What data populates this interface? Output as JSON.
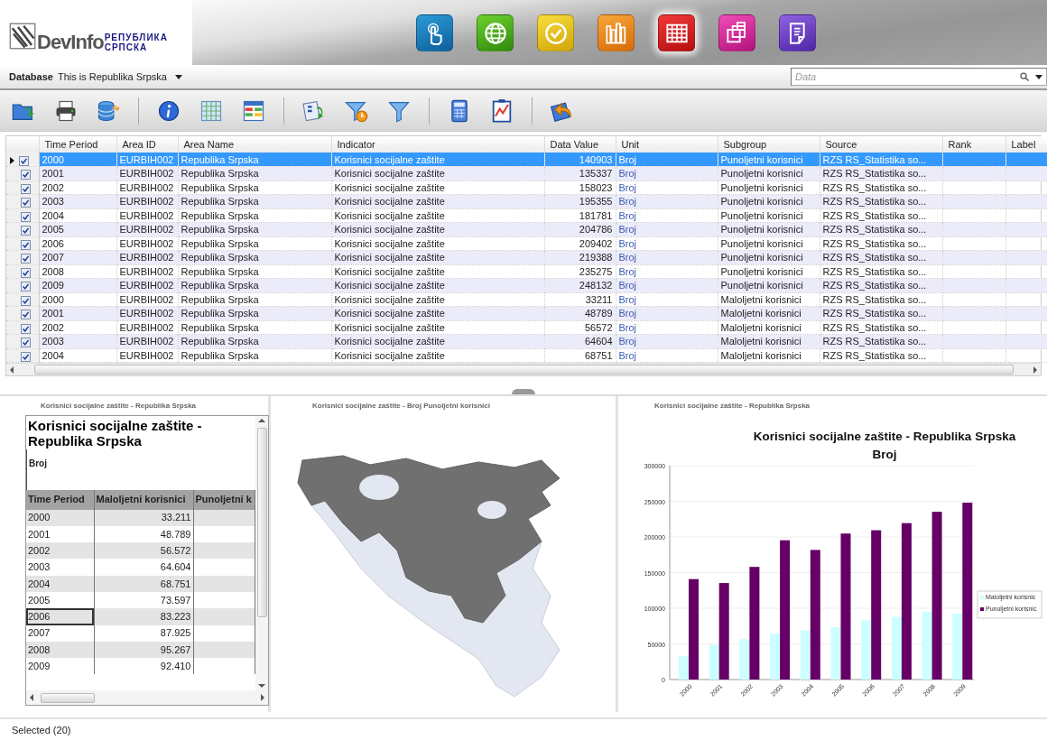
{
  "header": {
    "logo": {
      "name": "DevInfo",
      "line_1": "РЕПУБЛИКА",
      "line_2": "СРПСКА"
    },
    "app_icons": [
      {
        "kind": "touch",
        "selected": false
      },
      {
        "kind": "globe",
        "selected": false
      },
      {
        "kind": "check",
        "selected": false
      },
      {
        "kind": "books",
        "selected": false
      },
      {
        "kind": "grid",
        "selected": true
      },
      {
        "kind": "copy",
        "selected": false
      },
      {
        "kind": "document",
        "selected": false
      }
    ]
  },
  "database_bar": {
    "label": "Database",
    "value": "This is Republika Srpska"
  },
  "search": {
    "placeholder": "Data"
  },
  "table": {
    "columns": [
      "Time Period",
      "Area ID",
      "Area Name",
      "Indicator",
      "Data Value",
      "Unit",
      "Subgroup",
      "Source",
      "Rank",
      "Label"
    ],
    "rows": [
      {
        "selected": true,
        "checked": true,
        "cells": [
          "2000",
          "EURBIH002",
          "Republika Srpska",
          "Korisnici socijalne zaštite",
          "140903",
          "Broj",
          "Punoljetni korisnici",
          "RZS RS_Statistika so..."
        ]
      },
      {
        "selected": false,
        "checked": true,
        "cells": [
          "2001",
          "EURBIH002",
          "Republika Srpska",
          "Korisnici socijalne zaštite",
          "135337",
          "Broj",
          "Punoljetni korisnici",
          "RZS RS_Statistika so..."
        ]
      },
      {
        "selected": false,
        "checked": true,
        "cells": [
          "2002",
          "EURBIH002",
          "Republika Srpska",
          "Korisnici socijalne zaštite",
          "158023",
          "Broj",
          "Punoljetni korisnici",
          "RZS RS_Statistika so..."
        ]
      },
      {
        "selected": false,
        "checked": true,
        "cells": [
          "2003",
          "EURBIH002",
          "Republika Srpska",
          "Korisnici socijalne zaštite",
          "195355",
          "Broj",
          "Punoljetni korisnici",
          "RZS RS_Statistika so..."
        ]
      },
      {
        "selected": false,
        "checked": true,
        "cells": [
          "2004",
          "EURBIH002",
          "Republika Srpska",
          "Korisnici socijalne zaštite",
          "181781",
          "Broj",
          "Punoljetni korisnici",
          "RZS RS_Statistika so..."
        ]
      },
      {
        "selected": false,
        "checked": true,
        "cells": [
          "2005",
          "EURBIH002",
          "Republika Srpska",
          "Korisnici socijalne zaštite",
          "204786",
          "Broj",
          "Punoljetni korisnici",
          "RZS RS_Statistika so..."
        ]
      },
      {
        "selected": false,
        "checked": true,
        "cells": [
          "2006",
          "EURBIH002",
          "Republika Srpska",
          "Korisnici socijalne zaštite",
          "209402",
          "Broj",
          "Punoljetni korisnici",
          "RZS RS_Statistika so..."
        ]
      },
      {
        "selected": false,
        "checked": true,
        "cells": [
          "2007",
          "EURBIH002",
          "Republika Srpska",
          "Korisnici socijalne zaštite",
          "219388",
          "Broj",
          "Punoljetni korisnici",
          "RZS RS_Statistika so..."
        ]
      },
      {
        "selected": false,
        "checked": true,
        "cells": [
          "2008",
          "EURBIH002",
          "Republika Srpska",
          "Korisnici socijalne zaštite",
          "235275",
          "Broj",
          "Punoljetni korisnici",
          "RZS RS_Statistika so..."
        ]
      },
      {
        "selected": false,
        "checked": true,
        "cells": [
          "2009",
          "EURBIH002",
          "Republika Srpska",
          "Korisnici socijalne zaštite",
          "248132",
          "Broj",
          "Punoljetni korisnici",
          "RZS RS_Statistika so..."
        ]
      },
      {
        "selected": false,
        "checked": true,
        "cells": [
          "2000",
          "EURBIH002",
          "Republika Srpska",
          "Korisnici socijalne zaštite",
          "33211",
          "Broj",
          "Maloljetni korisnici",
          "RZS RS_Statistika so..."
        ]
      },
      {
        "selected": false,
        "checked": true,
        "cells": [
          "2001",
          "EURBIH002",
          "Republika Srpska",
          "Korisnici socijalne zaštite",
          "48789",
          "Broj",
          "Maloljetni korisnici",
          "RZS RS_Statistika so..."
        ]
      },
      {
        "selected": false,
        "checked": true,
        "cells": [
          "2002",
          "EURBIH002",
          "Republika Srpska",
          "Korisnici socijalne zaštite",
          "56572",
          "Broj",
          "Maloljetni korisnici",
          "RZS RS_Statistika so..."
        ]
      },
      {
        "selected": false,
        "checked": true,
        "cells": [
          "2003",
          "EURBIH002",
          "Republika Srpska",
          "Korisnici socijalne zaštite",
          "64604",
          "Broj",
          "Maloljetni korisnici",
          "RZS RS_Statistika so..."
        ]
      },
      {
        "selected": false,
        "checked": true,
        "cells": [
          "2004",
          "EURBIH002",
          "Republika Srpska",
          "Korisnici socijalne zaštite",
          "68751",
          "Broj",
          "Maloljetni korisnici",
          "RZS RS_Statistika so..."
        ]
      }
    ]
  },
  "report_panel": {
    "caption": "Korisnici socijalne zaštite - Republika Srpska",
    "title": "Korisnici socijalne zaštite - Republika Srpska",
    "subtitle": "Broj",
    "columns": [
      "Time Period",
      "Maloljetni korisnici",
      "Punoljetni k"
    ],
    "rows": [
      {
        "selected": false,
        "cells": [
          "2000",
          "33.211"
        ]
      },
      {
        "selected": false,
        "cells": [
          "2001",
          "48.789"
        ]
      },
      {
        "selected": false,
        "cells": [
          "2002",
          "56.572"
        ]
      },
      {
        "selected": false,
        "cells": [
          "2003",
          "64.604"
        ]
      },
      {
        "selected": false,
        "cells": [
          "2004",
          "68.751"
        ]
      },
      {
        "selected": false,
        "cells": [
          "2005",
          "73.597"
        ]
      },
      {
        "selected": true,
        "cells": [
          "2006",
          "83.223"
        ]
      },
      {
        "selected": false,
        "cells": [
          "2007",
          "87.925"
        ]
      },
      {
        "selected": false,
        "cells": [
          "2008",
          "95.267"
        ]
      },
      {
        "selected": false,
        "cells": [
          "2009",
          "92.410"
        ]
      }
    ]
  },
  "map_panel": {
    "caption": "Korisnici socijalne zaštite - Broj Punoljetni korisnici"
  },
  "chart_panel": {
    "caption": "Korisnici socijalne zaštite - Republika Srpska",
    "chart_data": {
      "type": "bar",
      "title": "Korisnici socijalne zaštite - Republika Srpska",
      "subtitle": "Broj",
      "categories": [
        "2000",
        "2001",
        "2002",
        "2003",
        "2004",
        "2005",
        "2006",
        "2007",
        "2008",
        "2009"
      ],
      "series": [
        {
          "name": "Maloljetni korisnic",
          "color": "#ccffff",
          "values": [
            33211,
            48789,
            56572,
            64604,
            68751,
            73597,
            83223,
            87925,
            95267,
            92410
          ]
        },
        {
          "name": "Punoljetni korisnic",
          "color": "#660066",
          "values": [
            140903,
            135337,
            158023,
            195355,
            181781,
            204786,
            209402,
            219388,
            235275,
            248132
          ]
        }
      ],
      "grid": true,
      "legend": true,
      "ylim": [
        0,
        300000
      ],
      "yticks": [
        0,
        50000,
        100000,
        150000,
        200000,
        250000,
        300000
      ]
    }
  },
  "status_bar": "Selected (20)"
}
